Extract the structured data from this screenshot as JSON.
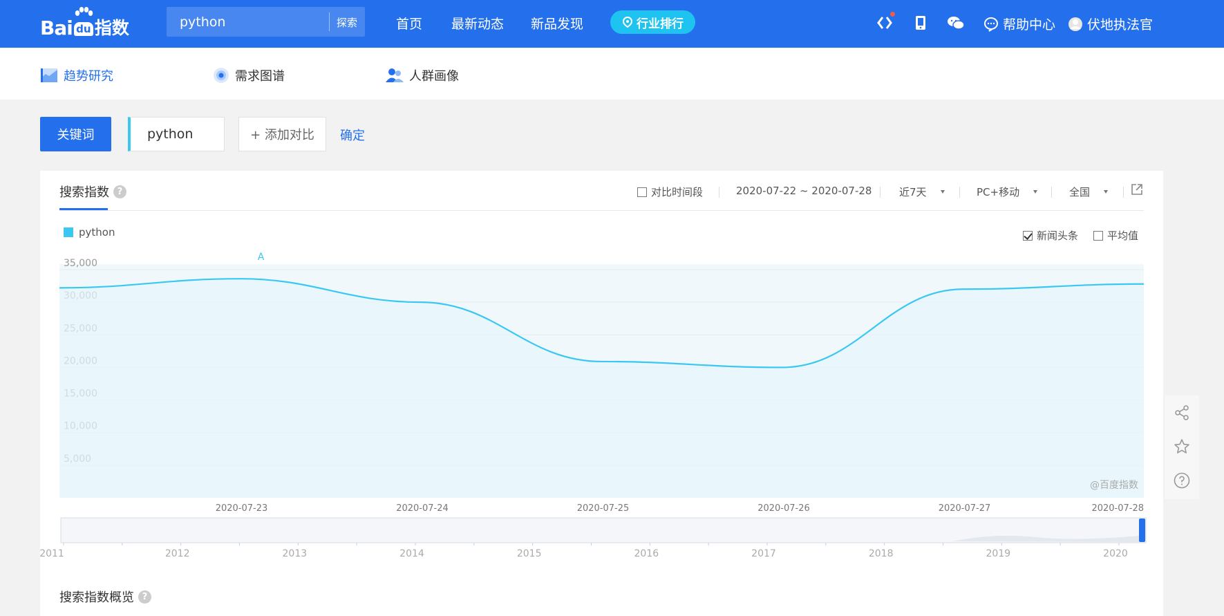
{
  "brand": {
    "logo_bai": "Bai",
    "logo_du": "du",
    "logo_zhishu": "指数"
  },
  "top_search": {
    "value": "python",
    "button": "探索"
  },
  "nav": [
    "首页",
    "最新动态",
    "新品发现"
  ],
  "rank_button": "行业排行",
  "top_icons": [
    "brand-icon",
    "tablet-icon",
    "wechat-icon"
  ],
  "help": "帮助中心",
  "user": "伏地执法官",
  "subnav": [
    {
      "label": "趋势研究",
      "icon": "trend-icon",
      "active": true
    },
    {
      "label": "需求图谱",
      "icon": "graph-icon",
      "active": false
    },
    {
      "label": "人群画像",
      "icon": "people-icon",
      "active": false
    }
  ],
  "keyword_label": "关键词",
  "keyword": "python",
  "add_compare": "+ 添加对比",
  "confirm": "确定",
  "card": {
    "title": "搜索指数",
    "help_icon": "?",
    "controls": {
      "compare_period": "对比时间段",
      "date_range": "2020-07-22 ~ 2020-07-28",
      "period": "近7天",
      "device": "PC+移动",
      "region": "全国"
    },
    "legend": "python",
    "options": {
      "news": "新闻头条",
      "news_checked": true,
      "avg": "平均值",
      "avg_checked": false
    },
    "watermark": "@百度指数",
    "section2_title": "搜索指数概览"
  },
  "colors": {
    "brand_blue": "#2470ec",
    "series": "#3ac7f2",
    "area_fill": "#f0f8fb"
  },
  "chart_data": {
    "type": "line",
    "title": "",
    "x": [
      "2020-07-22",
      "2020-07-23",
      "2020-07-24",
      "2020-07-25",
      "2020-07-26",
      "2020-07-27",
      "2020-07-28"
    ],
    "x_tick_labels": [
      "2020-07-23",
      "2020-07-24",
      "2020-07-25",
      "2020-07-26",
      "2020-07-27",
      "2020-07-28"
    ],
    "series": [
      {
        "name": "python",
        "values": [
          32200,
          33600,
          30000,
          20900,
          20000,
          32000,
          32800
        ]
      }
    ],
    "ylim": [
      0,
      35000
    ],
    "y_ticks": [
      5000,
      10000,
      15000,
      20000,
      25000,
      30000,
      35000
    ],
    "y_tick_labels": [
      "5,000",
      "10,000",
      "15,000",
      "20,000",
      "25,000",
      "30,000",
      "35,000"
    ],
    "area": true,
    "grid": true,
    "annotations": [
      {
        "label": "A",
        "x": "2020-07-23"
      }
    ],
    "overview_years": [
      "2011",
      "2012",
      "2013",
      "2014",
      "2015",
      "2016",
      "2017",
      "2018",
      "2019",
      "2020"
    ]
  }
}
